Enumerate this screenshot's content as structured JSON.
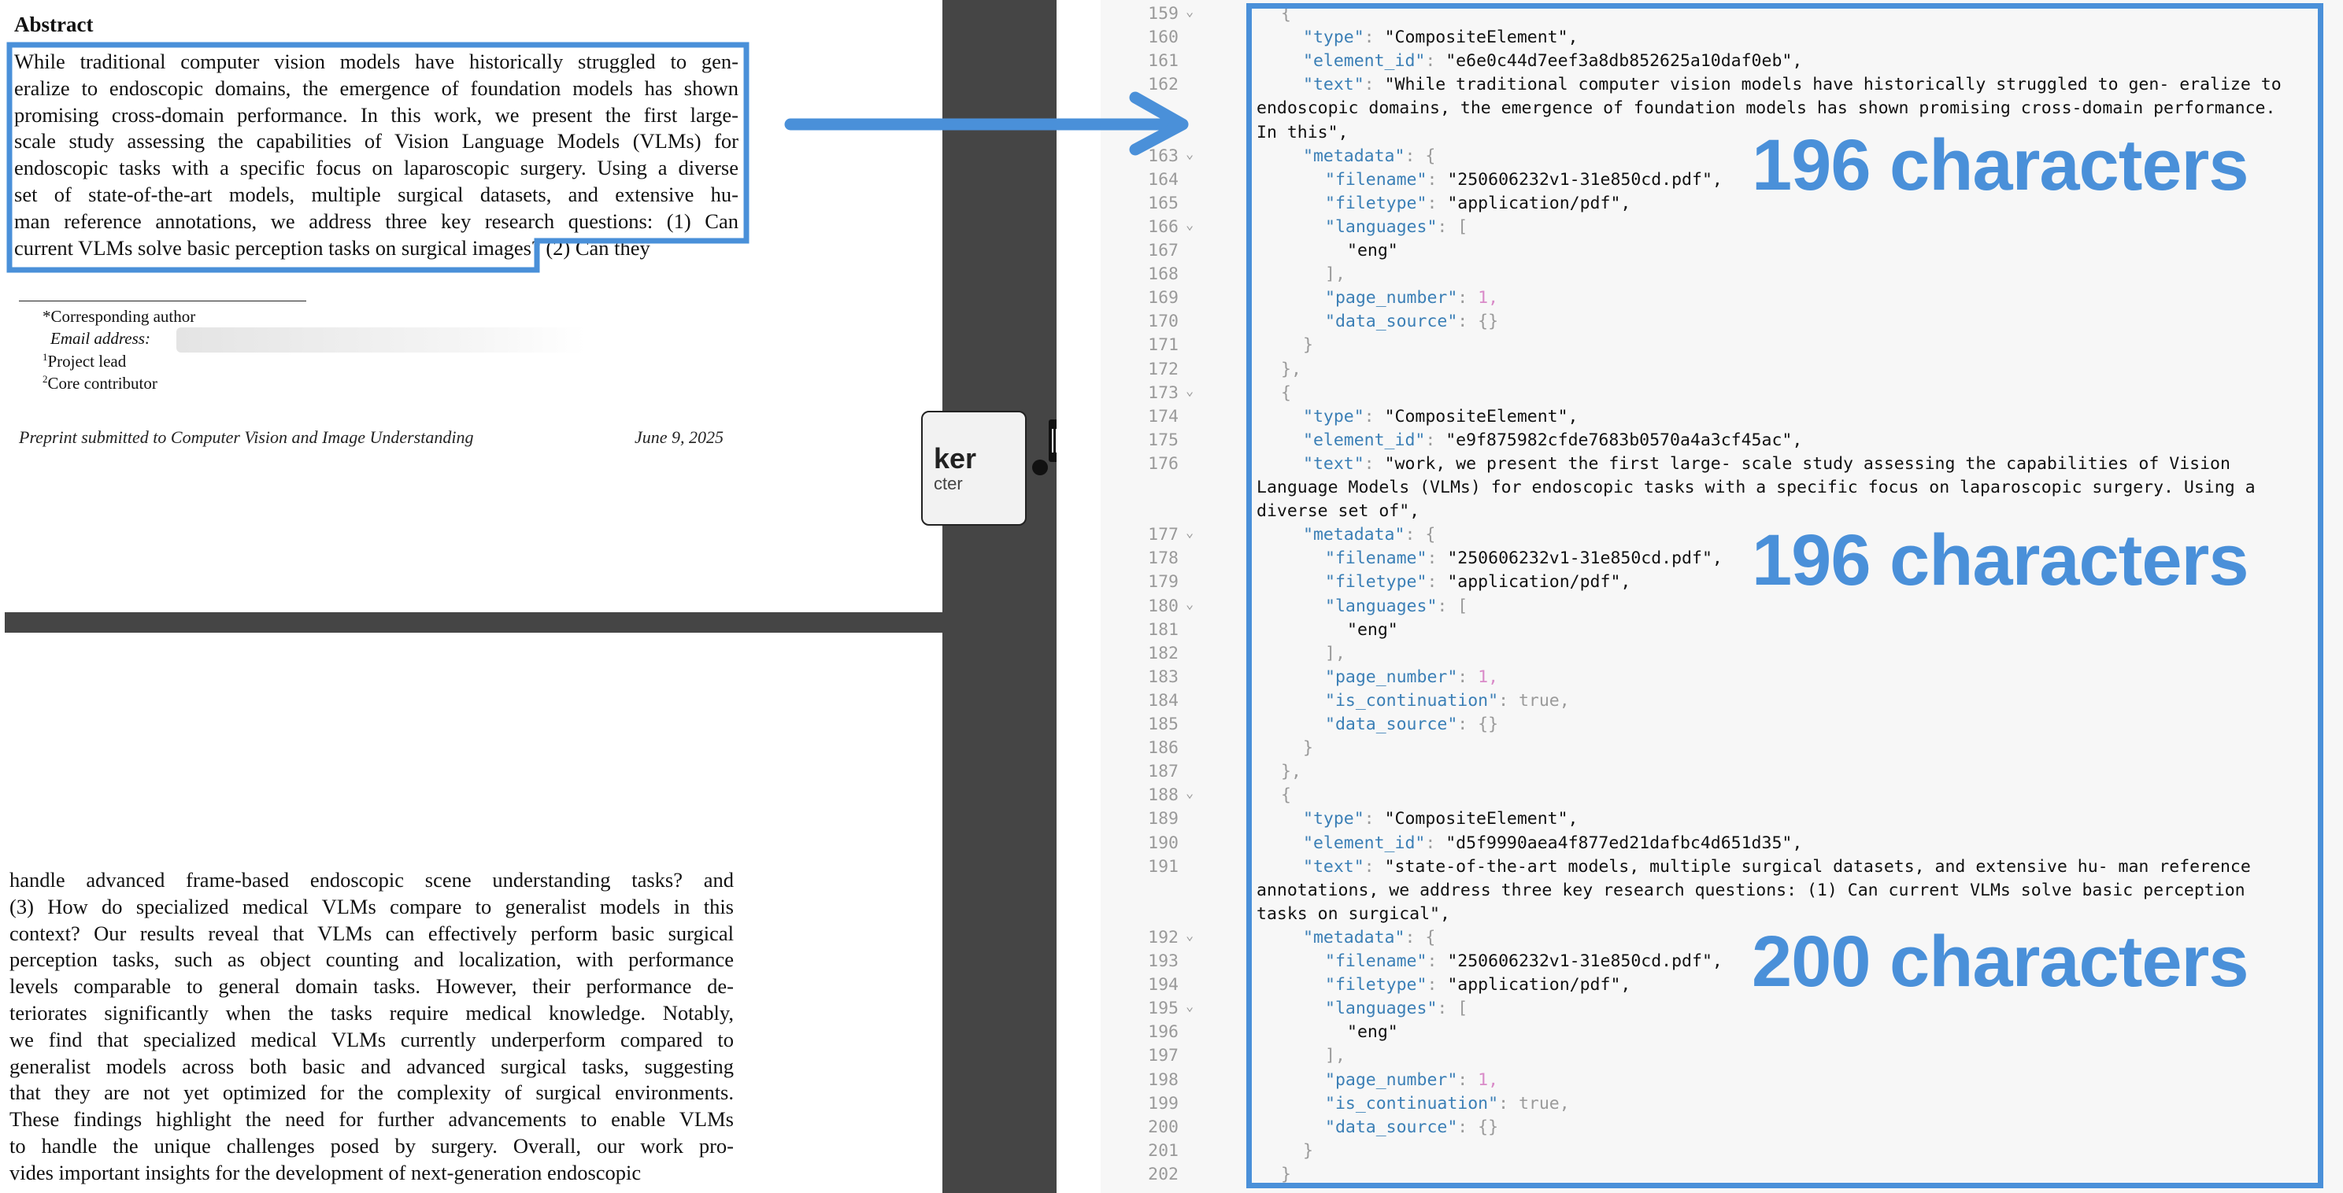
{
  "pdf": {
    "abstract_heading": "Abstract",
    "abstract_lines": [
      "While traditional computer vision models have historically struggled to gen-",
      "eralize to endoscopic domains, the emergence of foundation models has shown",
      "promising cross-domain performance. In this work, we present the first large-",
      "scale study assessing the capabilities of Vision Language Models (VLMs) for",
      "endoscopic tasks with a specific focus on laparoscopic surgery. Using a diverse",
      "set of state-of-the-art models, multiple surgical datasets, and extensive hu-",
      "man reference annotations, we address three key research questions: (1) Can",
      "current VLMs solve basic perception tasks on surgical images? (2) Can they"
    ],
    "footnotes": {
      "corresponding": "*Corresponding author",
      "email_label": "Email address:",
      "project_lead": "Project lead",
      "core_contributor": "Core contributor",
      "mark1": "1",
      "mark2": "2"
    },
    "preprint": "Preprint submitted to Computer Vision and Image Understanding",
    "date": "June 9, 2025",
    "continuation_lines": [
      "handle advanced frame-based endoscopic scene understanding tasks? and",
      "(3) How do specialized medical VLMs compare to generalist models in this",
      "context? Our results reveal that VLMs can effectively perform basic surgical",
      "perception tasks, such as object counting and localization, with performance",
      "levels comparable to general domain tasks. However, their performance de-",
      "teriorates significantly when the tasks require medical knowledge. Notably,",
      "we find that specialized medical VLMs currently underperform compared to",
      "generalist models across both basic and advanced surgical tasks, suggesting",
      "that they are not yet optimized for the complexity of surgical environments.",
      "These findings highlight the need for further advancements to enable VLMs",
      "to handle the unique challenges posed by surgery. Overall, our work pro-",
      "vides important insights for the development of next-generation endoscopic"
    ]
  },
  "popup": {
    "big": "ker",
    "small": "cter"
  },
  "editor": {
    "lines": [
      {
        "n": "159",
        "fold": true,
        "text": "{"
      },
      {
        "n": "160",
        "fold": false,
        "k": "\"type\"",
        "v": "\"CompositeElement\","
      },
      {
        "n": "161",
        "fold": false,
        "k": "\"element_id\"",
        "v": "\"e6e0c44d7eef3a8db852625a10daf0eb\","
      },
      {
        "n": "162",
        "fold": false,
        "k": "\"text\"",
        "v": "\"While traditional computer vision models have historically struggled to gen- eralize to"
      },
      {
        "n": "163",
        "fold": true,
        "k": "\"metadata\"",
        "v": "{"
      },
      {
        "n": "164",
        "fold": false,
        "k": "\"filename\"",
        "v": "\"250606232v1-31e850cd.pdf\","
      },
      {
        "n": "165",
        "fold": false,
        "k": "\"filetype\"",
        "v": "\"application/pdf\","
      },
      {
        "n": "166",
        "fold": true,
        "k": "\"languages\"",
        "v": "["
      },
      {
        "n": "167",
        "fold": false,
        "text": "\"eng\""
      },
      {
        "n": "168",
        "fold": false,
        "text": "],"
      },
      {
        "n": "169",
        "fold": false,
        "k": "\"page_number\"",
        "num": "1,"
      },
      {
        "n": "170",
        "fold": false,
        "k": "\"data_source\"",
        "v": "{}"
      },
      {
        "n": "171",
        "fold": false,
        "text": "}"
      },
      {
        "n": "172",
        "fold": false,
        "text": "},"
      },
      {
        "n": "173",
        "fold": true,
        "text": "{"
      },
      {
        "n": "174",
        "fold": false,
        "k": "\"type\"",
        "v": "\"CompositeElement\","
      },
      {
        "n": "175",
        "fold": false,
        "k": "\"element_id\"",
        "v": "\"e9f875982cfde7683b0570a4a3cf45ac\","
      },
      {
        "n": "176",
        "fold": false,
        "k": "\"text\"",
        "v": "\"work, we present the first large- scale study assessing the capabilities of Vision"
      },
      {
        "n": "177",
        "fold": true,
        "k": "\"metadata\"",
        "v": "{"
      },
      {
        "n": "178",
        "fold": false,
        "k": "\"filename\"",
        "v": "\"250606232v1-31e850cd.pdf\","
      },
      {
        "n": "179",
        "fold": false,
        "k": "\"filetype\"",
        "v": "\"application/pdf\","
      },
      {
        "n": "180",
        "fold": true,
        "k": "\"languages\"",
        "v": "["
      },
      {
        "n": "181",
        "fold": false,
        "text": "\"eng\""
      },
      {
        "n": "182",
        "fold": false,
        "text": "],"
      },
      {
        "n": "183",
        "fold": false,
        "k": "\"page_number\"",
        "num": "1,"
      },
      {
        "n": "184",
        "fold": false,
        "k": "\"is_continuation\"",
        "v": "true,"
      },
      {
        "n": "185",
        "fold": false,
        "k": "\"data_source\"",
        "v": "{}"
      },
      {
        "n": "186",
        "fold": false,
        "text": "}"
      },
      {
        "n": "187",
        "fold": false,
        "text": "},"
      },
      {
        "n": "188",
        "fold": true,
        "text": "{"
      },
      {
        "n": "189",
        "fold": false,
        "k": "\"type\"",
        "v": "\"CompositeElement\","
      },
      {
        "n": "190",
        "fold": false,
        "k": "\"element_id\"",
        "v": "\"d5f9990aea4f877ed21dafbc4d651d35\","
      },
      {
        "n": "191",
        "fold": false,
        "k": "\"text\"",
        "v": "\"state-of-the-art models, multiple surgical datasets, and extensive hu- man reference"
      },
      {
        "n": "192",
        "fold": true,
        "k": "\"metadata\"",
        "v": "{"
      },
      {
        "n": "193",
        "fold": false,
        "k": "\"filename\"",
        "v": "\"250606232v1-31e850cd.pdf\","
      },
      {
        "n": "194",
        "fold": false,
        "k": "\"filetype\"",
        "v": "\"application/pdf\","
      },
      {
        "n": "195",
        "fold": true,
        "k": "\"languages\"",
        "v": "["
      },
      {
        "n": "196",
        "fold": false,
        "text": "\"eng\""
      },
      {
        "n": "197",
        "fold": false,
        "text": "],"
      },
      {
        "n": "198",
        "fold": false,
        "k": "\"page_number\"",
        "num": "1,"
      },
      {
        "n": "199",
        "fold": false,
        "k": "\"is_continuation\"",
        "v": "true,"
      },
      {
        "n": "200",
        "fold": false,
        "k": "\"data_source\"",
        "v": "{}"
      },
      {
        "n": "201",
        "fold": false,
        "text": "}"
      },
      {
        "n": "202",
        "fold": false,
        "text": "}"
      }
    ],
    "text_continuations": {
      "c162a": "endoscopic domains, the emergence of foundation models has shown promising cross-domain performance.",
      "c162b": "In this\",",
      "c176a": "Language Models (VLMs) for endoscopic tasks with a specific focus on laparoscopic surgery. Using a",
      "c176b": "diverse set of\",",
      "c191a": "annotations, we address three key research questions: (1) Can current VLMs solve basic perception",
      "c191b": "tasks on surgical\","
    }
  },
  "annotations": {
    "label1": "196 characters",
    "label2": "196 characters",
    "label3": "200 characters",
    "accent_color": "#4a90d9"
  }
}
